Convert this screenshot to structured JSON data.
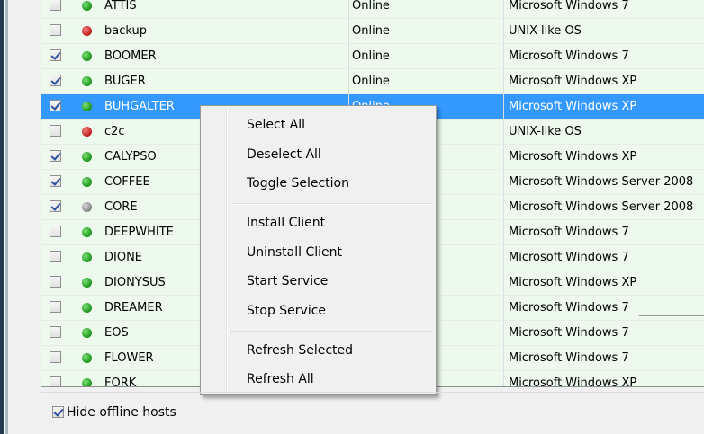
{
  "hosts": [
    {
      "checked": false,
      "status_color": "green",
      "name": "ATTIS",
      "status": "Online",
      "os": "Microsoft Windows 7"
    },
    {
      "checked": false,
      "status_color": "red",
      "name": "backup",
      "status": "Online",
      "os": "UNIX-like OS"
    },
    {
      "checked": true,
      "status_color": "green",
      "name": "BOOMER",
      "status": "Online",
      "os": "Microsoft Windows 7"
    },
    {
      "checked": true,
      "status_color": "green",
      "name": "BUGER",
      "status": "Online",
      "os": "Microsoft Windows XP"
    },
    {
      "checked": true,
      "status_color": "green",
      "name": "BUHGALTER",
      "status": "Online",
      "os": "Microsoft Windows XP",
      "selected": true
    },
    {
      "checked": false,
      "status_color": "red",
      "name": "c2c",
      "status": "",
      "os": "UNIX-like OS"
    },
    {
      "checked": true,
      "status_color": "green",
      "name": "CALYPSO",
      "status": "",
      "os": "Microsoft Windows XP"
    },
    {
      "checked": true,
      "status_color": "green",
      "name": "COFFEE",
      "status": "",
      "os": "Microsoft Windows Server 2008"
    },
    {
      "checked": true,
      "status_color": "gray",
      "name": "CORE",
      "status": "",
      "os": "Microsoft Windows Server 2008"
    },
    {
      "checked": false,
      "status_color": "green",
      "name": "DEEPWHITE",
      "status": "",
      "os": "Microsoft Windows 7"
    },
    {
      "checked": false,
      "status_color": "green",
      "name": "DIONE",
      "status": "",
      "os": "Microsoft Windows 7"
    },
    {
      "checked": false,
      "status_color": "green",
      "name": "DIONYSUS",
      "status": "",
      "os": "Microsoft Windows XP"
    },
    {
      "checked": false,
      "status_color": "green",
      "name": "DREAMER",
      "status": "",
      "os": "Microsoft Windows 7"
    },
    {
      "checked": false,
      "status_color": "green",
      "name": "EOS",
      "status": "",
      "os": "Microsoft Windows 7"
    },
    {
      "checked": false,
      "status_color": "green",
      "name": "FLOWER",
      "status": "",
      "os": "Microsoft Windows 7"
    },
    {
      "checked": false,
      "status_color": "green",
      "name": "FORK",
      "status": "",
      "os": "Microsoft Windows XP"
    }
  ],
  "context_menu": {
    "groups": [
      [
        "Select All",
        "Deselect All",
        "Toggle Selection"
      ],
      [
        "Install Client",
        "Uninstall Client",
        "Start Service",
        "Stop Service"
      ],
      [
        "Refresh Selected",
        "Refresh All"
      ]
    ]
  },
  "footer": {
    "hide_offline_label": "Hide offline hosts",
    "hide_offline_checked": true
  },
  "colors": {
    "row_bg": "#edf9ec",
    "selection": "#3399ff",
    "online": "#1f9a1f",
    "offline": "#c42121",
    "unknown": "#8a8a8a"
  }
}
